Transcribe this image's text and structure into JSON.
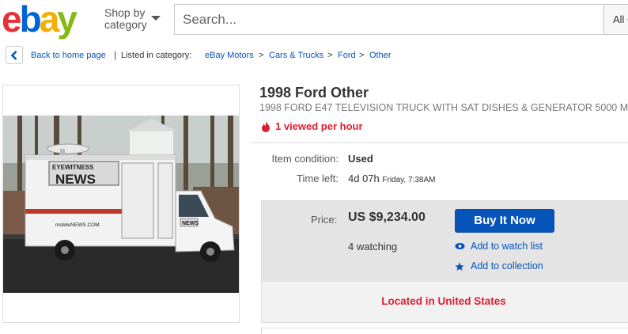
{
  "header": {
    "logo_letters": [
      "e",
      "b",
      "a",
      "y"
    ],
    "shop_by_line1": "Shop by",
    "shop_by_line2": "category",
    "search_placeholder": "Search...",
    "category_select": "All C"
  },
  "breadcrumb": {
    "back_label": "Back to home page",
    "separator": "|",
    "listed_in": "Listed in category:",
    "items": [
      "eBay Motors",
      "Cars & Trucks",
      "Ford",
      "Other"
    ],
    "arrow": ">"
  },
  "listing": {
    "title": "1998 Ford Other",
    "subtitle": "1998 FORD E47 TELEVISION TRUCK WITH SAT DISHES & GENERATOR 5000 M",
    "views": "1 viewed per hour",
    "condition_label": "Item condition:",
    "condition_value": "Used",
    "time_label": "Time left:",
    "time_value": "4d 07h",
    "time_extra": "Friday, 7:38AM",
    "price_label": "Price:",
    "price_value": "US $9,234.00",
    "watching": "4 watching",
    "buy_label": "Buy It Now",
    "watch_label": "Add to watch list",
    "collection_label": "Add to collection",
    "location": "Located in United States"
  },
  "photo": {
    "sign_main": "NEWS",
    "sign_top": "EYEWITNESS",
    "cab_sign": "NEWS",
    "side_text": "mobileNEWS.COM"
  },
  "colors": {
    "logo_e": "#e53238",
    "logo_b": "#0064d2",
    "logo_a": "#f5af02",
    "logo_y": "#86b817",
    "link": "#0654ba",
    "alert": "#dd1e31",
    "buy_button": "#0654ba"
  }
}
